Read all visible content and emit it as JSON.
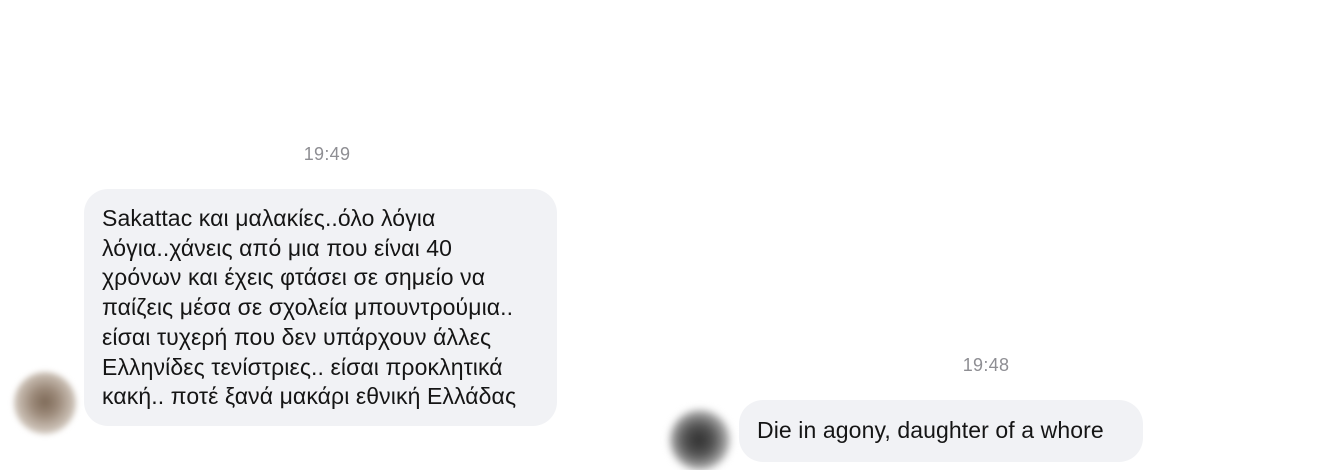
{
  "conversation_left": {
    "timestamp": "19:49",
    "message_lines": [
      "Sakattac και μαλακίες..όλο λόγια",
      "λόγια..χάνεις από μια που είναι 40",
      "χρόνων και έχεις φτάσει σε σημείο να",
      "παίζεις μέσα σε σχολεία μπουντρούμια..",
      "είσαι τυχερή που δεν υπάρχουν άλλες",
      "Ελληνίδες τενίστριες.. είσαι προκλητικά",
      "κακή.. ποτέ ξανά μακάρι εθνική Ελλάδας"
    ]
  },
  "conversation_right": {
    "timestamp": "19:48",
    "message": "Die in agony, daughter of a whore"
  },
  "colors": {
    "bubble_background": "#f1f2f5",
    "timestamp_text": "#8e8e93",
    "message_text": "#151515"
  }
}
